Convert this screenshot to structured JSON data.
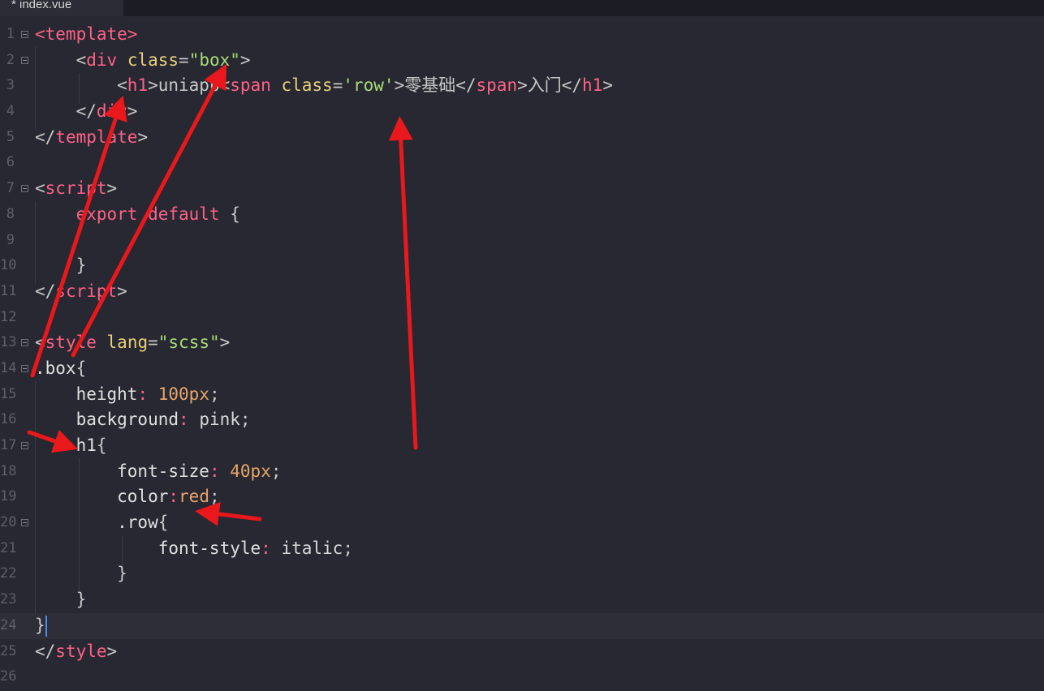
{
  "tab": {
    "title": "* index.vue"
  },
  "lines": [
    {
      "num": "1",
      "fold": true,
      "tokens": [
        [
          "tag",
          "<template>"
        ]
      ]
    },
    {
      "num": "2",
      "fold": true,
      "tokens": [
        [
          "punc",
          "    <"
        ],
        [
          "tag",
          "div"
        ],
        [
          "punc",
          " "
        ],
        [
          "attr",
          "class"
        ],
        [
          "punc",
          "="
        ],
        [
          "str",
          "\"box\""
        ],
        [
          "punc",
          ">"
        ]
      ]
    },
    {
      "num": "3",
      "fold": false,
      "tokens": [
        [
          "punc",
          "        <"
        ],
        [
          "tag",
          "h1"
        ],
        [
          "punc",
          ">uniapp<"
        ],
        [
          "tag",
          "span"
        ],
        [
          "punc",
          " "
        ],
        [
          "attr",
          "class"
        ],
        [
          "punc",
          "="
        ],
        [
          "str",
          "'row'"
        ],
        [
          "punc",
          ">零基础</"
        ],
        [
          "tag",
          "span"
        ],
        [
          "punc",
          ">入门</"
        ],
        [
          "tag",
          "h1"
        ],
        [
          "punc",
          ">"
        ]
      ]
    },
    {
      "num": "4",
      "fold": false,
      "tokens": [
        [
          "punc",
          "    </"
        ],
        [
          "tag",
          "div"
        ],
        [
          "punc",
          ">"
        ]
      ]
    },
    {
      "num": "5",
      "fold": false,
      "tokens": [
        [
          "punc",
          "</"
        ],
        [
          "tag",
          "template"
        ],
        [
          "punc",
          ">"
        ]
      ]
    },
    {
      "num": "6",
      "fold": false,
      "tokens": []
    },
    {
      "num": "7",
      "fold": true,
      "tokens": [
        [
          "punc",
          "<"
        ],
        [
          "tag",
          "script"
        ],
        [
          "punc",
          ">"
        ]
      ]
    },
    {
      "num": "8",
      "fold": false,
      "tokens": [
        [
          "kw",
          "    export default"
        ],
        [
          "punc",
          " {"
        ]
      ]
    },
    {
      "num": "9",
      "fold": false,
      "tokens": []
    },
    {
      "num": "10",
      "fold": false,
      "tokens": [
        [
          "punc",
          "    }"
        ]
      ]
    },
    {
      "num": "11",
      "fold": false,
      "tokens": [
        [
          "punc",
          "</"
        ],
        [
          "tag",
          "script"
        ],
        [
          "punc",
          ">"
        ]
      ]
    },
    {
      "num": "12",
      "fold": false,
      "tokens": []
    },
    {
      "num": "13",
      "fold": true,
      "tokens": [
        [
          "punc",
          "<"
        ],
        [
          "tag",
          "style"
        ],
        [
          "punc",
          " "
        ],
        [
          "attr",
          "lang"
        ],
        [
          "punc",
          "="
        ],
        [
          "str",
          "\"scss\""
        ],
        [
          "punc",
          ">"
        ]
      ]
    },
    {
      "num": "14",
      "fold": true,
      "tokens": [
        [
          "sel",
          ".box"
        ],
        [
          "punc",
          "{"
        ]
      ]
    },
    {
      "num": "15",
      "fold": false,
      "tokens": [
        [
          "prop",
          "    height"
        ],
        [
          "kw",
          ":"
        ],
        [
          "punc",
          " "
        ],
        [
          "num",
          "100px"
        ],
        [
          "punc",
          ";"
        ]
      ]
    },
    {
      "num": "16",
      "fold": false,
      "tokens": [
        [
          "prop",
          "    background"
        ],
        [
          "kw",
          ":"
        ],
        [
          "punc",
          " "
        ],
        [
          "val",
          "pink"
        ],
        [
          "punc",
          ";"
        ]
      ]
    },
    {
      "num": "17",
      "fold": true,
      "tokens": [
        [
          "sel",
          "    h1"
        ],
        [
          "punc",
          "{"
        ]
      ]
    },
    {
      "num": "18",
      "fold": false,
      "tokens": [
        [
          "prop",
          "        font-size"
        ],
        [
          "kw",
          ":"
        ],
        [
          "punc",
          " "
        ],
        [
          "num",
          "40px"
        ],
        [
          "punc",
          ";"
        ]
      ]
    },
    {
      "num": "19",
      "fold": false,
      "tokens": [
        [
          "prop",
          "        color"
        ],
        [
          "kw",
          ":"
        ],
        [
          "num",
          "red"
        ],
        [
          "punc",
          ";"
        ]
      ]
    },
    {
      "num": "20",
      "fold": true,
      "tokens": [
        [
          "sel",
          "        .row"
        ],
        [
          "punc",
          "{"
        ]
      ]
    },
    {
      "num": "21",
      "fold": false,
      "tokens": [
        [
          "prop",
          "            font-style"
        ],
        [
          "kw",
          ":"
        ],
        [
          "punc",
          " "
        ],
        [
          "val",
          "italic"
        ],
        [
          "punc",
          ";"
        ]
      ]
    },
    {
      "num": "22",
      "fold": false,
      "tokens": [
        [
          "punc",
          "        }"
        ]
      ]
    },
    {
      "num": "23",
      "fold": false,
      "tokens": [
        [
          "punc",
          "    }"
        ]
      ]
    },
    {
      "num": "24",
      "fold": false,
      "active": true,
      "cursor": true,
      "tokens": [
        [
          "punc",
          "}"
        ]
      ]
    },
    {
      "num": "25",
      "fold": false,
      "tokens": [
        [
          "punc",
          "</"
        ],
        [
          "tag",
          "style"
        ],
        [
          "punc",
          ">"
        ]
      ]
    },
    {
      "num": "26",
      "fold": false,
      "tokens": []
    }
  ],
  "annotation_color": "#e8181c"
}
